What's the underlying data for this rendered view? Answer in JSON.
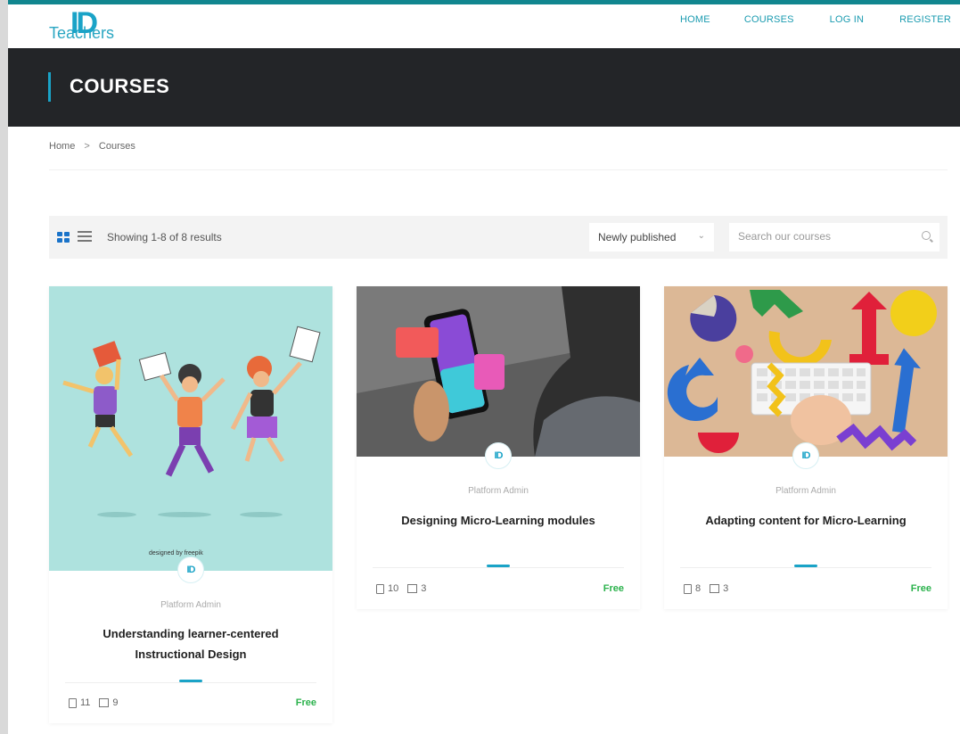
{
  "header": {
    "logo_mark": "ID",
    "logo_text": "Teachers",
    "nav": [
      "HOME",
      "COURSES",
      "LOG IN",
      "REGISTER"
    ]
  },
  "banner": {
    "title": "COURSES"
  },
  "breadcrumb": {
    "home": "Home",
    "separator": ">",
    "current": "Courses"
  },
  "toolbar": {
    "results_text": "Showing 1-8 of 8 results",
    "sort_value": "Newly published",
    "search_placeholder": "Search our courses"
  },
  "courses": [
    {
      "thumbnail": "illustration of three students jumping",
      "thumb_credit": "designed by freepik",
      "avatar": "ID",
      "author": "Platform Admin",
      "title": "Understanding learner-centered Instructional Design",
      "lessons": "11",
      "students": "9",
      "price": "Free"
    },
    {
      "thumbnail": "hand holding smartphone",
      "avatar": "ID",
      "author": "Platform Admin",
      "title": "Designing Micro-Learning modules",
      "lessons": "10",
      "students": "3",
      "price": "Free"
    },
    {
      "thumbnail": "colorful shapes and keyboard",
      "avatar": "ID",
      "author": "Platform Admin",
      "title": "Adapting content for Micro-Learning",
      "lessons": "8",
      "students": "3",
      "price": "Free"
    }
  ],
  "colors": {
    "accent": "#1aa3c7",
    "banner_bg": "#232528",
    "price": "#2bb24c"
  }
}
